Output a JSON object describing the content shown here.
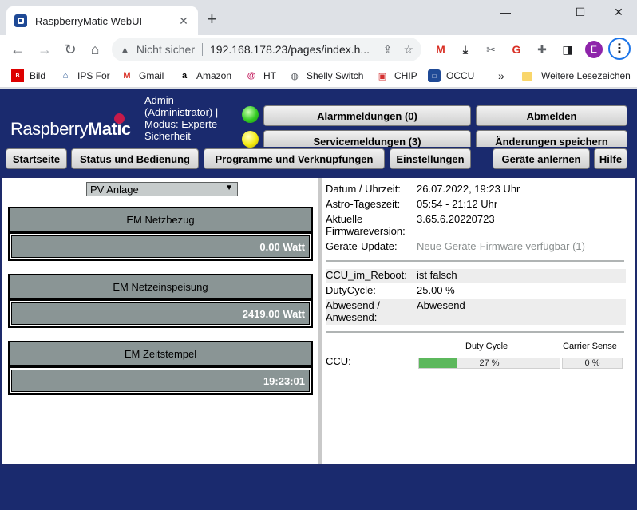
{
  "browser": {
    "tab_title": "RaspberryMatic WebUI",
    "tab_close": "✕",
    "new_tab": "+",
    "window_controls": [
      "—",
      "☐",
      "✕"
    ],
    "not_secure": "Nicht sicher",
    "url": "192.168.178.23/pages/index.h...",
    "profile_initial": "E",
    "bookmarks": [
      "Bild",
      "IPS For",
      "Gmail",
      "Amazon",
      "HT",
      "Shelly Switch",
      "CHIP",
      "OCCU"
    ],
    "more_bookmarks": "»",
    "other_bookmarks": "Weitere Lesezeichen"
  },
  "header": {
    "logo_prefix": "Raspberry",
    "logo_suffix": "Matic",
    "user_info": "Admin (Administrator) | Modus: Experte Sicherheit",
    "alarm_button": "Alarmmeldungen (0)",
    "logout_button": "Abmelden",
    "service_button": "Servicemeldungen (3)",
    "save_button": "Änderungen speichern",
    "nav": [
      "Startseite",
      "Status und Bedienung",
      "Programme und Verknüpfungen",
      "Einstellungen"
    ],
    "teach_button": "Geräte anlernen",
    "help_button": "Hilfe"
  },
  "left": {
    "select_value": "PV Anlage",
    "devices": [
      {
        "name": "EM Netzbezug",
        "value": "0.00 Watt"
      },
      {
        "name": "EM Netzeinspeisung",
        "value": "2419.00 Watt"
      },
      {
        "name": "EM Zeitstempel",
        "value": "19:23:01"
      }
    ]
  },
  "right": {
    "datetime_label": "Datum / Uhrzeit:",
    "datetime_value": "26.07.2022, 19:23 Uhr",
    "astro_label": "Astro-Tageszeit:",
    "astro_value": "05:54 - 21:12 Uhr",
    "firmware_label": "Aktuelle Firmwareversion:",
    "firmware_value": "3.65.6.20220723",
    "update_label": "Geräte-Update:",
    "update_value": "Neue Geräte-Firmware verfügbar (1)",
    "reboot_label": "CCU_im_Reboot:",
    "reboot_value": "ist falsch",
    "duty_label": "DutyCycle:",
    "duty_value": "25.00 %",
    "absent_label": "Abwesend / Anwesend:",
    "absent_value": "Abwesend",
    "duty_cycle_header": "Duty Cycle",
    "carrier_sense_header": "Carrier Sense",
    "ccu_label": "CCU:",
    "duty_cycle_percent": 27,
    "duty_cycle_text": "27 %",
    "carrier_sense_percent": 0,
    "carrier_sense_text": "0 %"
  }
}
